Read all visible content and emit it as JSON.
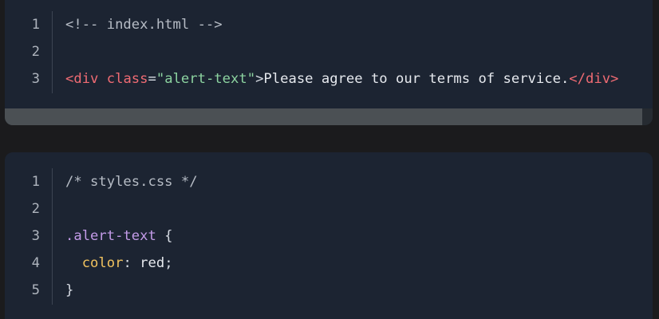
{
  "theme": {
    "page_bg": "#1b1b1d",
    "block_bg": "#1c2432",
    "tag_color": "#ef6b73",
    "string_color": "#8cd3a0",
    "selector_color": "#c39be8",
    "property_color": "#f2c35f"
  },
  "html_block": {
    "lines": [
      {
        "num": "1",
        "tokens": [
          {
            "t": "<!-- index.html -->",
            "c": "comment"
          }
        ]
      },
      {
        "num": "2",
        "tokens": []
      },
      {
        "num": "3",
        "tokens": [
          {
            "t": "<",
            "c": "tag"
          },
          {
            "t": "div",
            "c": "tag"
          },
          {
            "t": " ",
            "c": "punct"
          },
          {
            "t": "class",
            "c": "attr"
          },
          {
            "t": "=",
            "c": "punct"
          },
          {
            "t": "\"alert-text\"",
            "c": "str"
          },
          {
            "t": ">",
            "c": "punct"
          },
          {
            "t": "Please agree to our terms of service.",
            "c": "plain"
          },
          {
            "t": "</",
            "c": "tag"
          },
          {
            "t": "div",
            "c": "tag"
          },
          {
            "t": ">",
            "c": "tag"
          }
        ]
      }
    ],
    "scrollbar_thumb_fraction": 0.984
  },
  "css_block": {
    "lines": [
      {
        "num": "1",
        "tokens": [
          {
            "t": "/* styles.css */",
            "c": "comment"
          }
        ]
      },
      {
        "num": "2",
        "tokens": []
      },
      {
        "num": "3",
        "tokens": [
          {
            "t": ".alert-text",
            "c": "sel"
          },
          {
            "t": " {",
            "c": "punct"
          }
        ]
      },
      {
        "num": "4",
        "tokens": [
          {
            "t": "  ",
            "c": "punct"
          },
          {
            "t": "color",
            "c": "prop"
          },
          {
            "t": ": ",
            "c": "punct"
          },
          {
            "t": "red",
            "c": "plain"
          },
          {
            "t": ";",
            "c": "punct"
          }
        ]
      },
      {
        "num": "5",
        "tokens": [
          {
            "t": "}",
            "c": "punct"
          }
        ]
      }
    ]
  }
}
